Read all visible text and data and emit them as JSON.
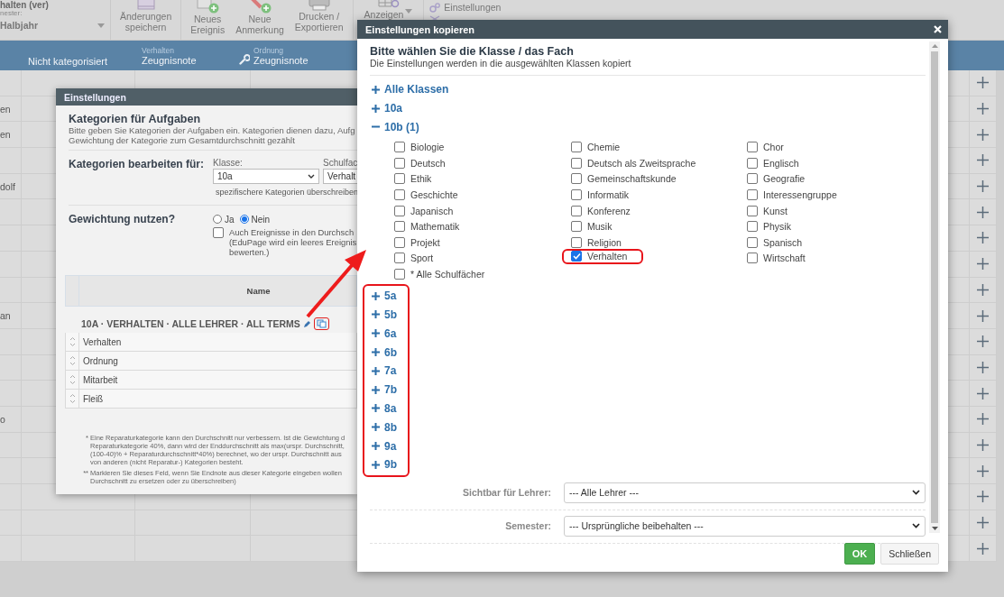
{
  "toolbar": {
    "class_value": "halten (ver)",
    "semester_label": "nester:",
    "semester_value": "Halbjahr",
    "buttons": [
      {
        "kind": "save",
        "label": "Änderungen\nspeichern"
      },
      {
        "kind": "event",
        "label": "Neues\nEreignis"
      },
      {
        "kind": "note",
        "label": "Neue\nAnmerkung"
      },
      {
        "kind": "print",
        "label": "Drucken /\nExportieren"
      },
      {
        "kind": "view",
        "label": "Anzeigen"
      }
    ],
    "settings_link": "Einstellungen"
  },
  "header": {
    "columns": [
      {
        "kind": "text",
        "label": "Nicht kategorisiert"
      },
      {
        "kind": "category",
        "caption": "Verhalten",
        "label": "Zeugnisnote"
      },
      {
        "kind": "tool"
      },
      {
        "kind": "category",
        "caption": "Ordnung",
        "label": "Zeugnisnote"
      }
    ]
  },
  "grid": {
    "rows": [
      {},
      {
        "name": "en"
      },
      {
        "name": "en"
      },
      {},
      {
        "name": "dolf"
      },
      {},
      {},
      {},
      {},
      {
        "name": "an"
      },
      {},
      {},
      {},
      {
        "name": "o"
      },
      {},
      {},
      {},
      {},
      {}
    ]
  },
  "settings_dialog": {
    "title": "Einstellungen",
    "heading": "Kategorien für Aufgaben",
    "description": "Bitte geben Sie Kategorien der Aufgaben ein. Kategorien dienen dazu, Aufg\nGewichtung der Kategorie zum Gesamtdurchschnitt gezählt",
    "edit_label": "Kategorien bearbeiten für:",
    "class_label": "Klasse:",
    "class_value": "10a",
    "subject_label": "Schulfac",
    "subject_value": "Verhalt",
    "override_hint": "spezifischere Kategorien überschreiben",
    "weighting_label": "Gewichtung nutzen?",
    "weighting_options": [
      {
        "label": "Ja",
        "selected": false
      },
      {
        "label": "Nein",
        "selected": true
      }
    ],
    "include_events": {
      "checked": false,
      "label": "Auch Ereignisse in den Durchsch\n(EduPage wird ein leeres Ereignis\nbewerten.)"
    },
    "table_header": "Name",
    "group_title": "10A · VERHALTEN · ALLE LEHRER · ALL TERMS",
    "categories": [
      "Verhalten",
      "Ordnung",
      "Mitarbeit",
      "Fleiß"
    ],
    "footnotes": [
      {
        "mark": "*",
        "text": "Eine Reparaturkategorie kann den Durchschnitt nur verbessern. Ist die Gewichtung d\nReparaturkategorie 40%, dann wird der Enddurchschnitt als max(urspr. Durchschnitt,\n(100-40)% + Reparaturdurchschnitt*40%) berechnet, wo der urspr. Durchschnitt aus\nvon anderen (nicht Reparatur-) Kategorien besteht."
      },
      {
        "mark": "**",
        "text": "Markieren Sie dieses Feld, wenn Sie Endnote aus dieser Kategorie eingeben wollen\nDurchschnitt zu ersetzen oder zu überschreiben)"
      }
    ]
  },
  "copy_dialog": {
    "title": "Einstellungen kopieren",
    "heading": "Bitte wählen Sie die Klasse / das Fach",
    "subtitle": "Die Einstellungen werden in die ausgewählten Klassen kopiert",
    "tree": [
      {
        "label": "Alle Klassen",
        "expanded": false
      },
      {
        "label": "10a",
        "expanded": false
      },
      {
        "label": "10b (1)",
        "expanded": true,
        "subjects": [
          {
            "label": "Biologie",
            "checked": false
          },
          {
            "label": "Chemie",
            "checked": false
          },
          {
            "label": "Chor",
            "checked": false
          },
          {
            "label": "Deutsch",
            "checked": false
          },
          {
            "label": "Deutsch als Zweitsprache",
            "checked": false
          },
          {
            "label": "Englisch",
            "checked": false
          },
          {
            "label": "Ethik",
            "checked": false
          },
          {
            "label": "Gemeinschaftskunde",
            "checked": false
          },
          {
            "label": "Geografie",
            "checked": false
          },
          {
            "label": "Geschichte",
            "checked": false
          },
          {
            "label": "Informatik",
            "checked": false
          },
          {
            "label": "Interessengruppe",
            "checked": false
          },
          {
            "label": "Japanisch",
            "checked": false
          },
          {
            "label": "Konferenz",
            "checked": false
          },
          {
            "label": "Kunst",
            "checked": false
          },
          {
            "label": "Mathematik",
            "checked": false
          },
          {
            "label": "Musik",
            "checked": false
          },
          {
            "label": "Physik",
            "checked": false
          },
          {
            "label": "Projekt",
            "checked": false
          },
          {
            "label": "Religion",
            "checked": false
          },
          {
            "label": "Spanisch",
            "checked": false
          },
          {
            "label": "Sport",
            "checked": false
          },
          {
            "label": "Verhalten",
            "checked": true
          },
          {
            "label": "Wirtschaft",
            "checked": false
          },
          {
            "label": "* Alle Schulfächer",
            "checked": false
          }
        ]
      },
      {
        "label": "5a",
        "expanded": false
      },
      {
        "label": "5b",
        "expanded": false
      },
      {
        "label": "6a",
        "expanded": false
      },
      {
        "label": "6b",
        "expanded": false
      },
      {
        "label": "7a",
        "expanded": false
      },
      {
        "label": "7b",
        "expanded": false
      },
      {
        "label": "8a",
        "expanded": false
      },
      {
        "label": "8b",
        "expanded": false
      },
      {
        "label": "9a",
        "expanded": false
      },
      {
        "label": "9b",
        "expanded": false
      }
    ],
    "visible_label": "Sichtbar für Lehrer:",
    "visible_value": "--- Alle Lehrer ---",
    "semester_label": "Semester:",
    "semester_value": "--- Ursprüngliche beibehalten ---",
    "ok_button": "OK",
    "close_button": "Schließen"
  }
}
